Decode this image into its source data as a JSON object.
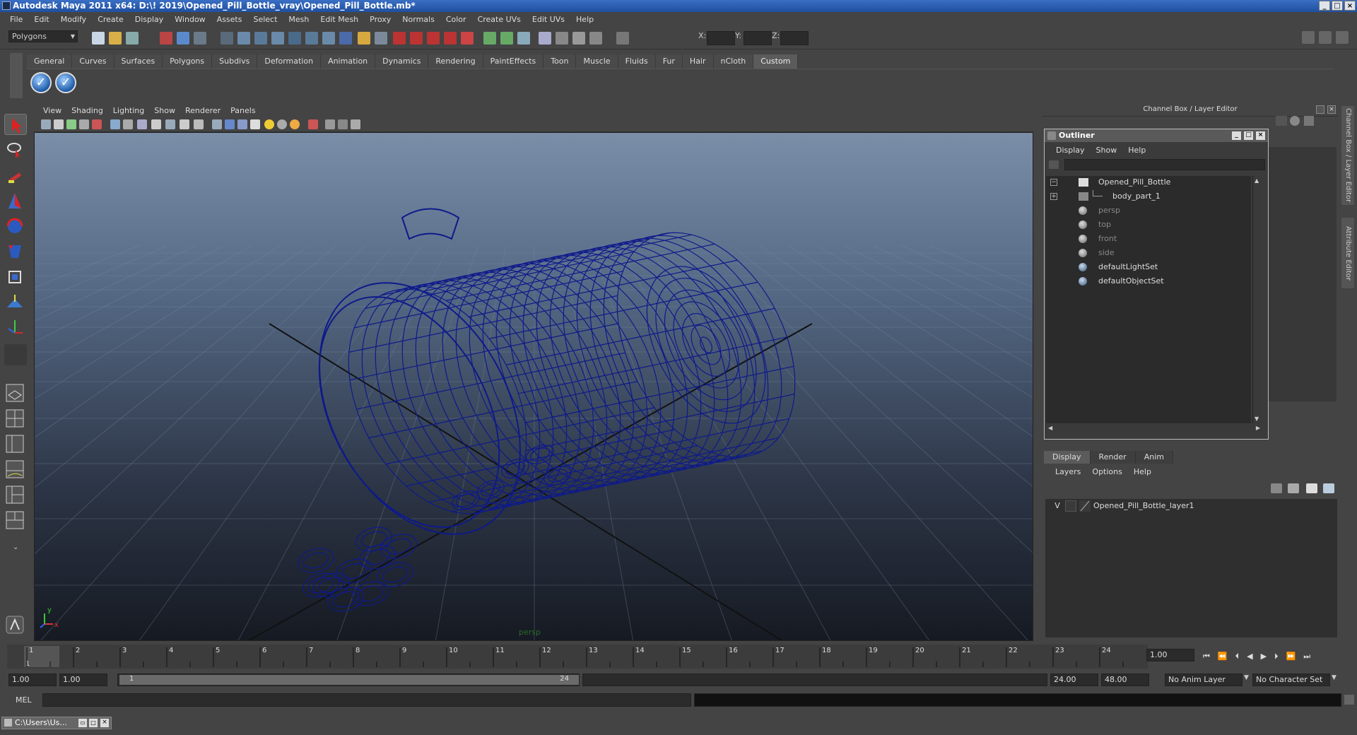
{
  "window": {
    "title": "Autodesk Maya 2011 x64: D:\\! 2019\\Opened_Pill_Bottle_vray\\Opened_Pill_Bottle.mb*",
    "controls": [
      "_",
      "□",
      "×"
    ]
  },
  "menubar": [
    "File",
    "Edit",
    "Modify",
    "Create",
    "Display",
    "Window",
    "Assets",
    "Select",
    "Mesh",
    "Edit Mesh",
    "Proxy",
    "Normals",
    "Color",
    "Create UVs",
    "Edit UVs",
    "Help"
  ],
  "statusline": {
    "mode_select": "Polygons",
    "x_label": "X:",
    "y_label": "Y:",
    "z_label": "Z:"
  },
  "shelf": {
    "tabs": [
      "General",
      "Curves",
      "Surfaces",
      "Polygons",
      "Subdivs",
      "Deformation",
      "Animation",
      "Dynamics",
      "Rendering",
      "PaintEffects",
      "Toon",
      "Muscle",
      "Fluids",
      "Fur",
      "Hair",
      "nCloth",
      "Custom"
    ],
    "active_tab": "Custom"
  },
  "viewport": {
    "menu": [
      "View",
      "Shading",
      "Lighting",
      "Show",
      "Renderer",
      "Panels"
    ],
    "camera_label": "persp",
    "axis_x": "x",
    "axis_y": "y",
    "wire_color": "#0e1a8a"
  },
  "timeline": {
    "ticks": [
      "1",
      "2",
      "3",
      "4",
      "5",
      "6",
      "7",
      "8",
      "9",
      "10",
      "11",
      "12",
      "13",
      "14",
      "15",
      "16",
      "17",
      "18",
      "19",
      "20",
      "21",
      "22",
      "23",
      "24"
    ],
    "current_frame_marker": "1",
    "current_time": "1.00"
  },
  "range": {
    "start": "1.00",
    "playback_start": "1.00",
    "slider_start": "1",
    "slider_end": "24",
    "playback_end": "24.00",
    "end": "48.00",
    "anim_layer": "No Anim Layer",
    "character_set": "No Character Set"
  },
  "cmdline": {
    "label": "MEL"
  },
  "taskbar": {
    "item": "C:\\Users\\Us..."
  },
  "channelbox": {
    "title": "Channel Box / Layer Editor",
    "side_tabs": [
      "Channel Box / Layer Editor",
      "Attribute Editor"
    ]
  },
  "outliner": {
    "title": "Outliner",
    "menu": [
      "Display",
      "Show",
      "Help"
    ],
    "items": [
      "Opened_Pill_Bottle",
      "body_part_1",
      "persp",
      "top",
      "front",
      "side",
      "defaultLightSet",
      "defaultObjectSet"
    ]
  },
  "layers": {
    "tabs": [
      "Display",
      "Render",
      "Anim"
    ],
    "active_tab": "Display",
    "menu": [
      "Layers",
      "Options",
      "Help"
    ],
    "visibility": "V",
    "layer_name": "Opened_Pill_Bottle_layer1"
  }
}
